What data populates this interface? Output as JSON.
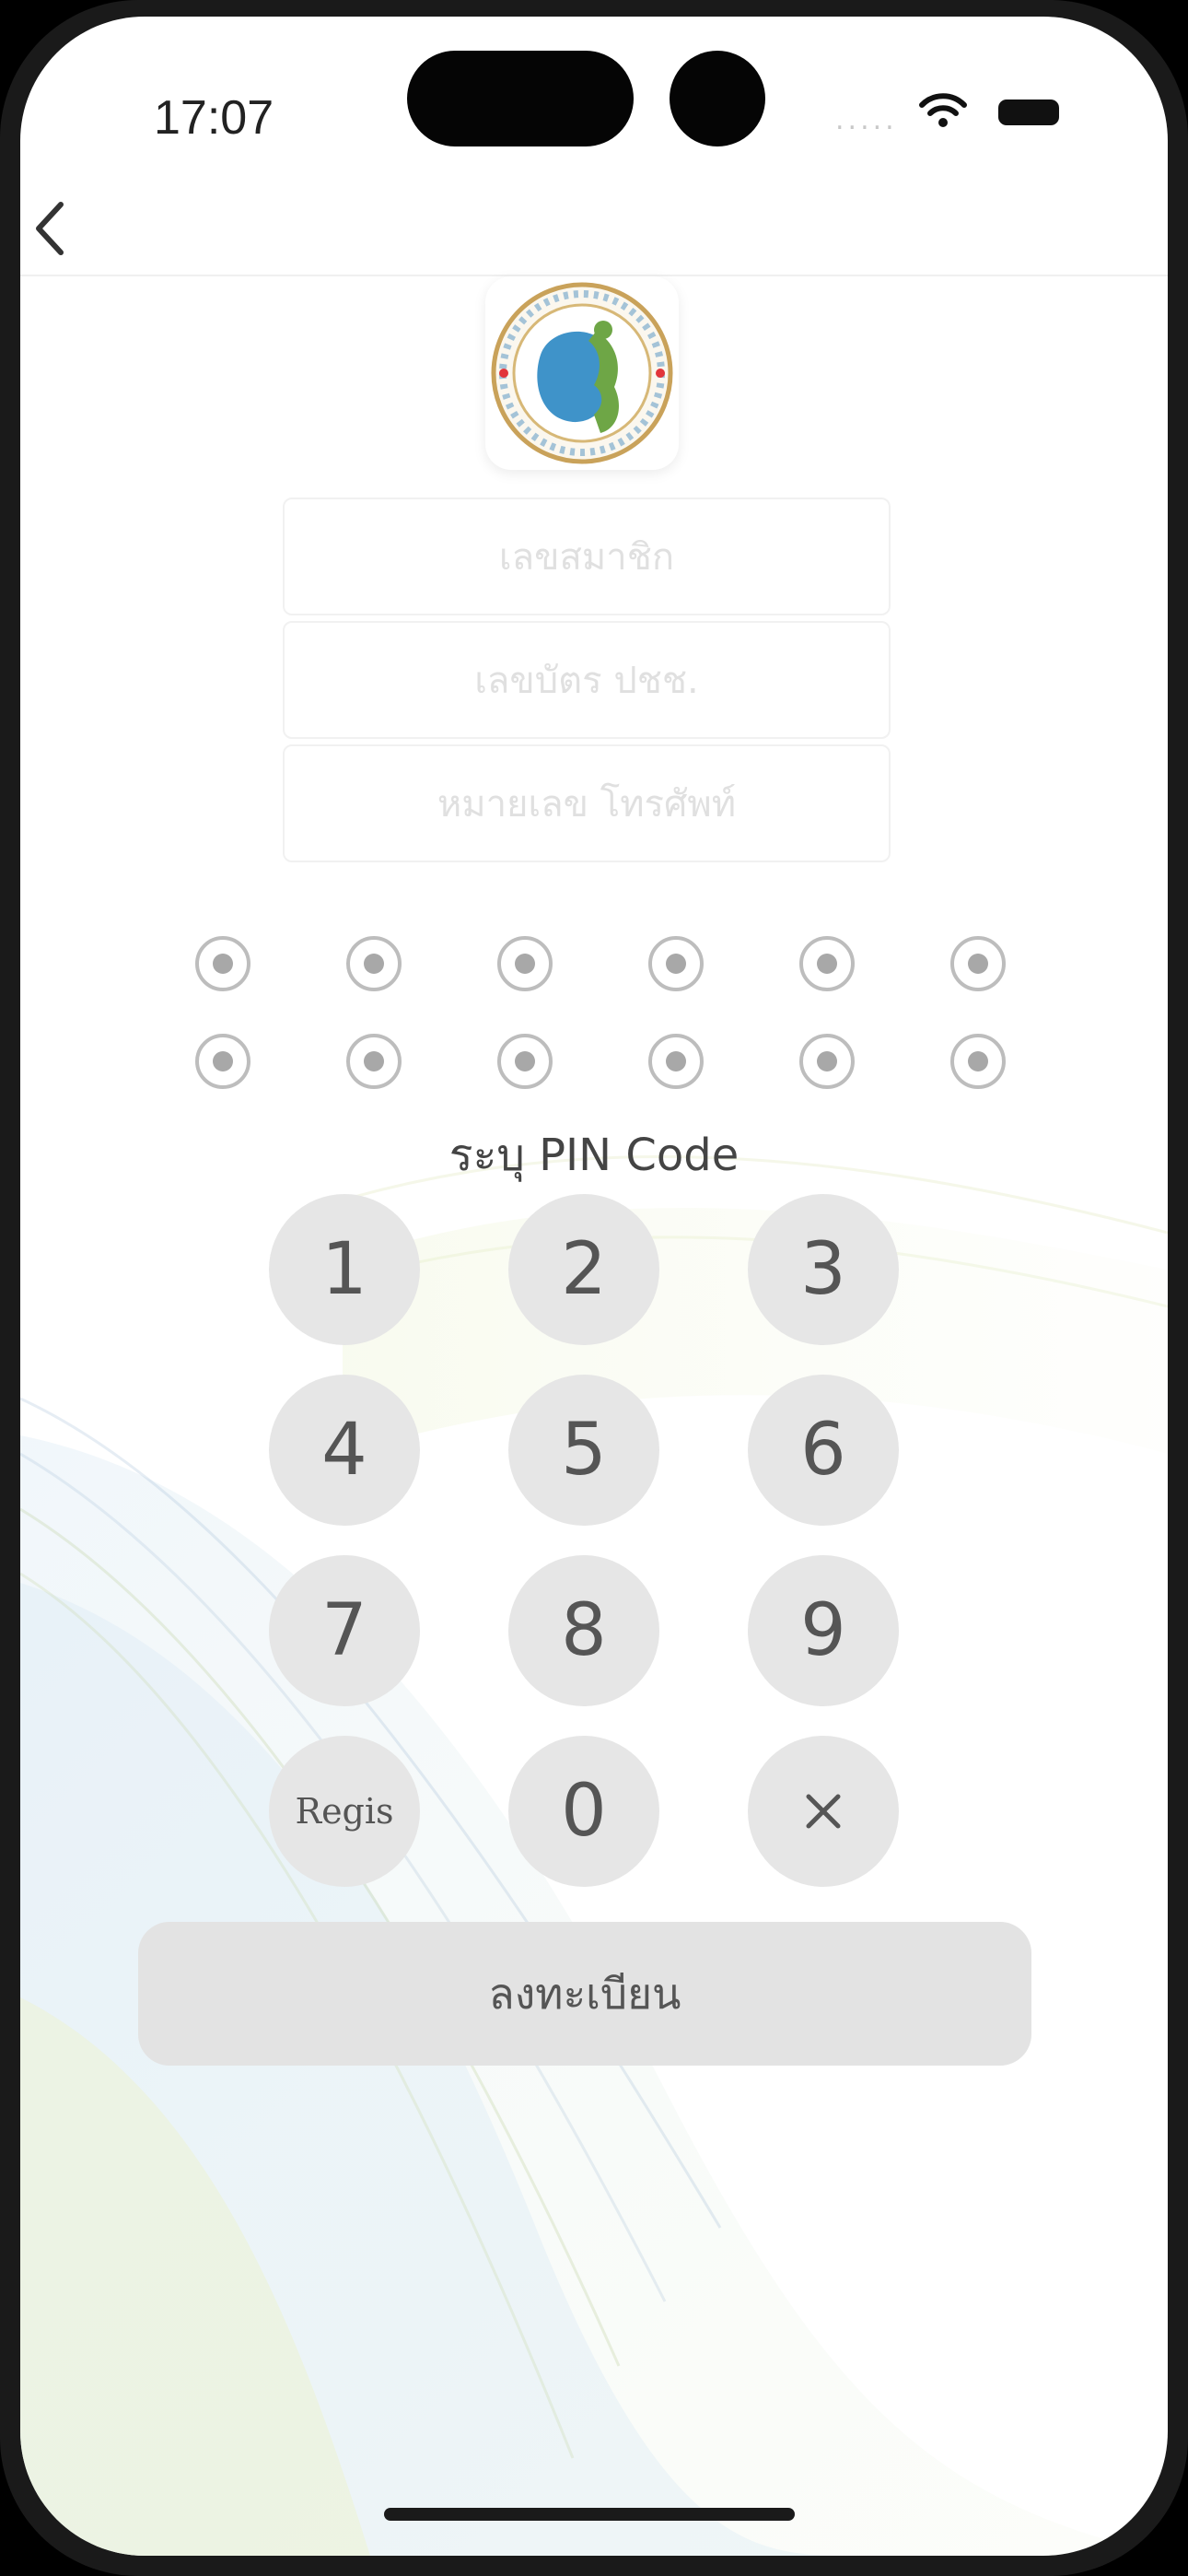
{
  "status_bar": {
    "time": "17:07",
    "signal": "....."
  },
  "header": {
    "back_icon": "chevron-left-icon"
  },
  "logo": {
    "icon": "association-seal-logo"
  },
  "form": {
    "member_no_placeholder": "เลขสมาชิก",
    "id_card_placeholder": "เลขบัตร ปชช.",
    "phone_placeholder": "หมายเลข โทรศัพท์"
  },
  "pin": {
    "rows": [
      {
        "filled": 6,
        "length": 6
      },
      {
        "filled": 6,
        "length": 6
      }
    ],
    "label": "ระบุ PIN Code"
  },
  "keypad": {
    "keys": [
      "1",
      "2",
      "3",
      "4",
      "5",
      "6",
      "7",
      "8",
      "9"
    ],
    "regis_label": "Regis",
    "zero_label": "0",
    "delete_icon": "close-icon"
  },
  "register_button": {
    "label": "ลงทะเบียน"
  },
  "colors": {
    "key_bg": "#e6e6e6",
    "button_bg": "#e3e3e3",
    "text": "#555555"
  }
}
